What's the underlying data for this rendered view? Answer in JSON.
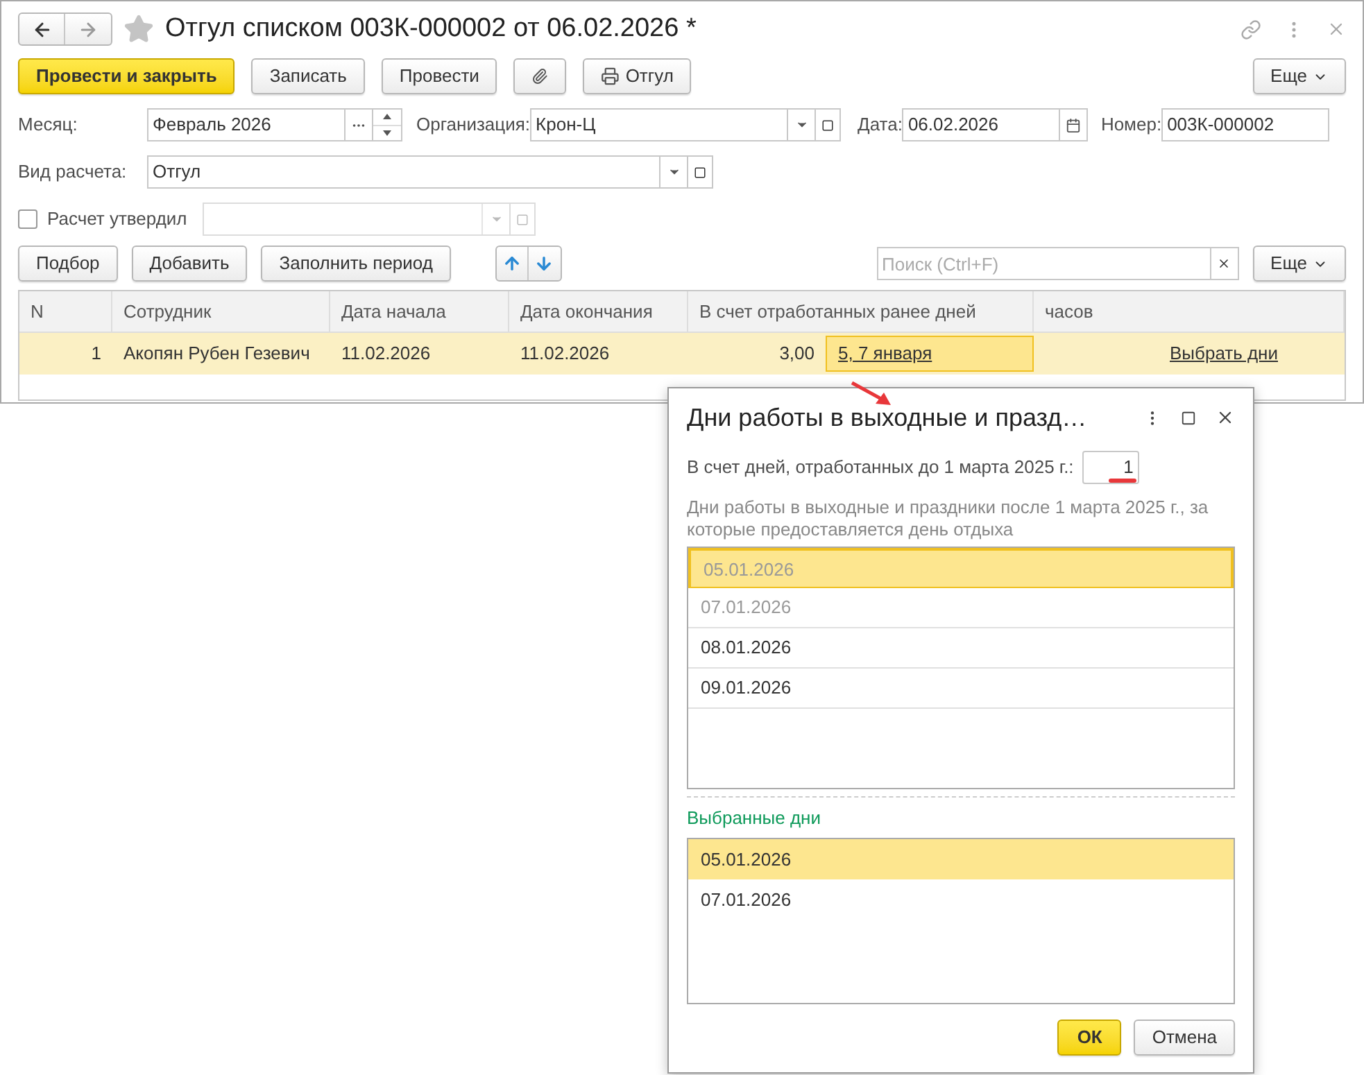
{
  "window": {
    "title": "Отгул списком 003К-000002 от 06.02.2026 *"
  },
  "toolbar": {
    "buttons": [
      {
        "label": "Провести и закрыть",
        "kind": "primary"
      },
      {
        "label": "Записать",
        "kind": "default"
      },
      {
        "label": "Провести",
        "kind": "default"
      },
      {
        "kind": "attach"
      },
      {
        "label": "Отгул",
        "kind": "print"
      }
    ],
    "more": "Еще"
  },
  "form": {
    "month": {
      "label": "Месяц:",
      "value": "Февраль 2026"
    },
    "organization": {
      "label": "Организация:",
      "value": "Крон-Ц"
    },
    "date": {
      "label": "Дата:",
      "value": "06.02.2026"
    },
    "number": {
      "label": "Номер:",
      "value": "003К-000002"
    },
    "calc_type": {
      "label": "Вид расчета:",
      "value": "Отгул"
    },
    "approved": {
      "label": "Расчет утвердил",
      "checked": false
    }
  },
  "table_toolbar": {
    "buttons": [
      "Подбор",
      "Добавить",
      "Заполнить период"
    ],
    "search_placeholder": "Поиск (Ctrl+F)",
    "more": "Еще"
  },
  "table": {
    "columns": [
      "N",
      "Сотрудник",
      "Дата начала",
      "Дата окончания",
      "В счет отработанных ранее дней",
      "часов"
    ],
    "rows": [
      {
        "n": "1",
        "employee": "Акопян Рубен Гезевич",
        "start": "11.02.2026",
        "end": "11.02.2026",
        "days": "3,00",
        "days_link": "5, 7 января",
        "action": "Выбрать дни",
        "selected": true
      }
    ]
  },
  "dialog": {
    "title": "Дни работы в выходные и празд…",
    "before_label": "В счет дней, отработанных до 1 марта 2025 г.:",
    "before_value": "1",
    "after_label": "Дни работы в выходные и праздники после 1 марта 2025 г., за которые предоставляется день отдыха",
    "days": [
      {
        "date": "05.01.2026",
        "selected": true,
        "disabled": true
      },
      {
        "date": "07.01.2026",
        "selected": false,
        "disabled": true
      },
      {
        "date": "08.01.2026",
        "selected": false,
        "disabled": false
      },
      {
        "date": "09.01.2026",
        "selected": false,
        "disabled": false
      }
    ],
    "chosen_label": "Выбранные дни",
    "chosen": [
      {
        "date": "05.01.2026",
        "selected": true
      },
      {
        "date": "07.01.2026",
        "selected": false
      }
    ],
    "buttons": [
      {
        "label": "ОК",
        "kind": "primary"
      },
      {
        "label": "Отмена",
        "kind": "default"
      }
    ]
  }
}
